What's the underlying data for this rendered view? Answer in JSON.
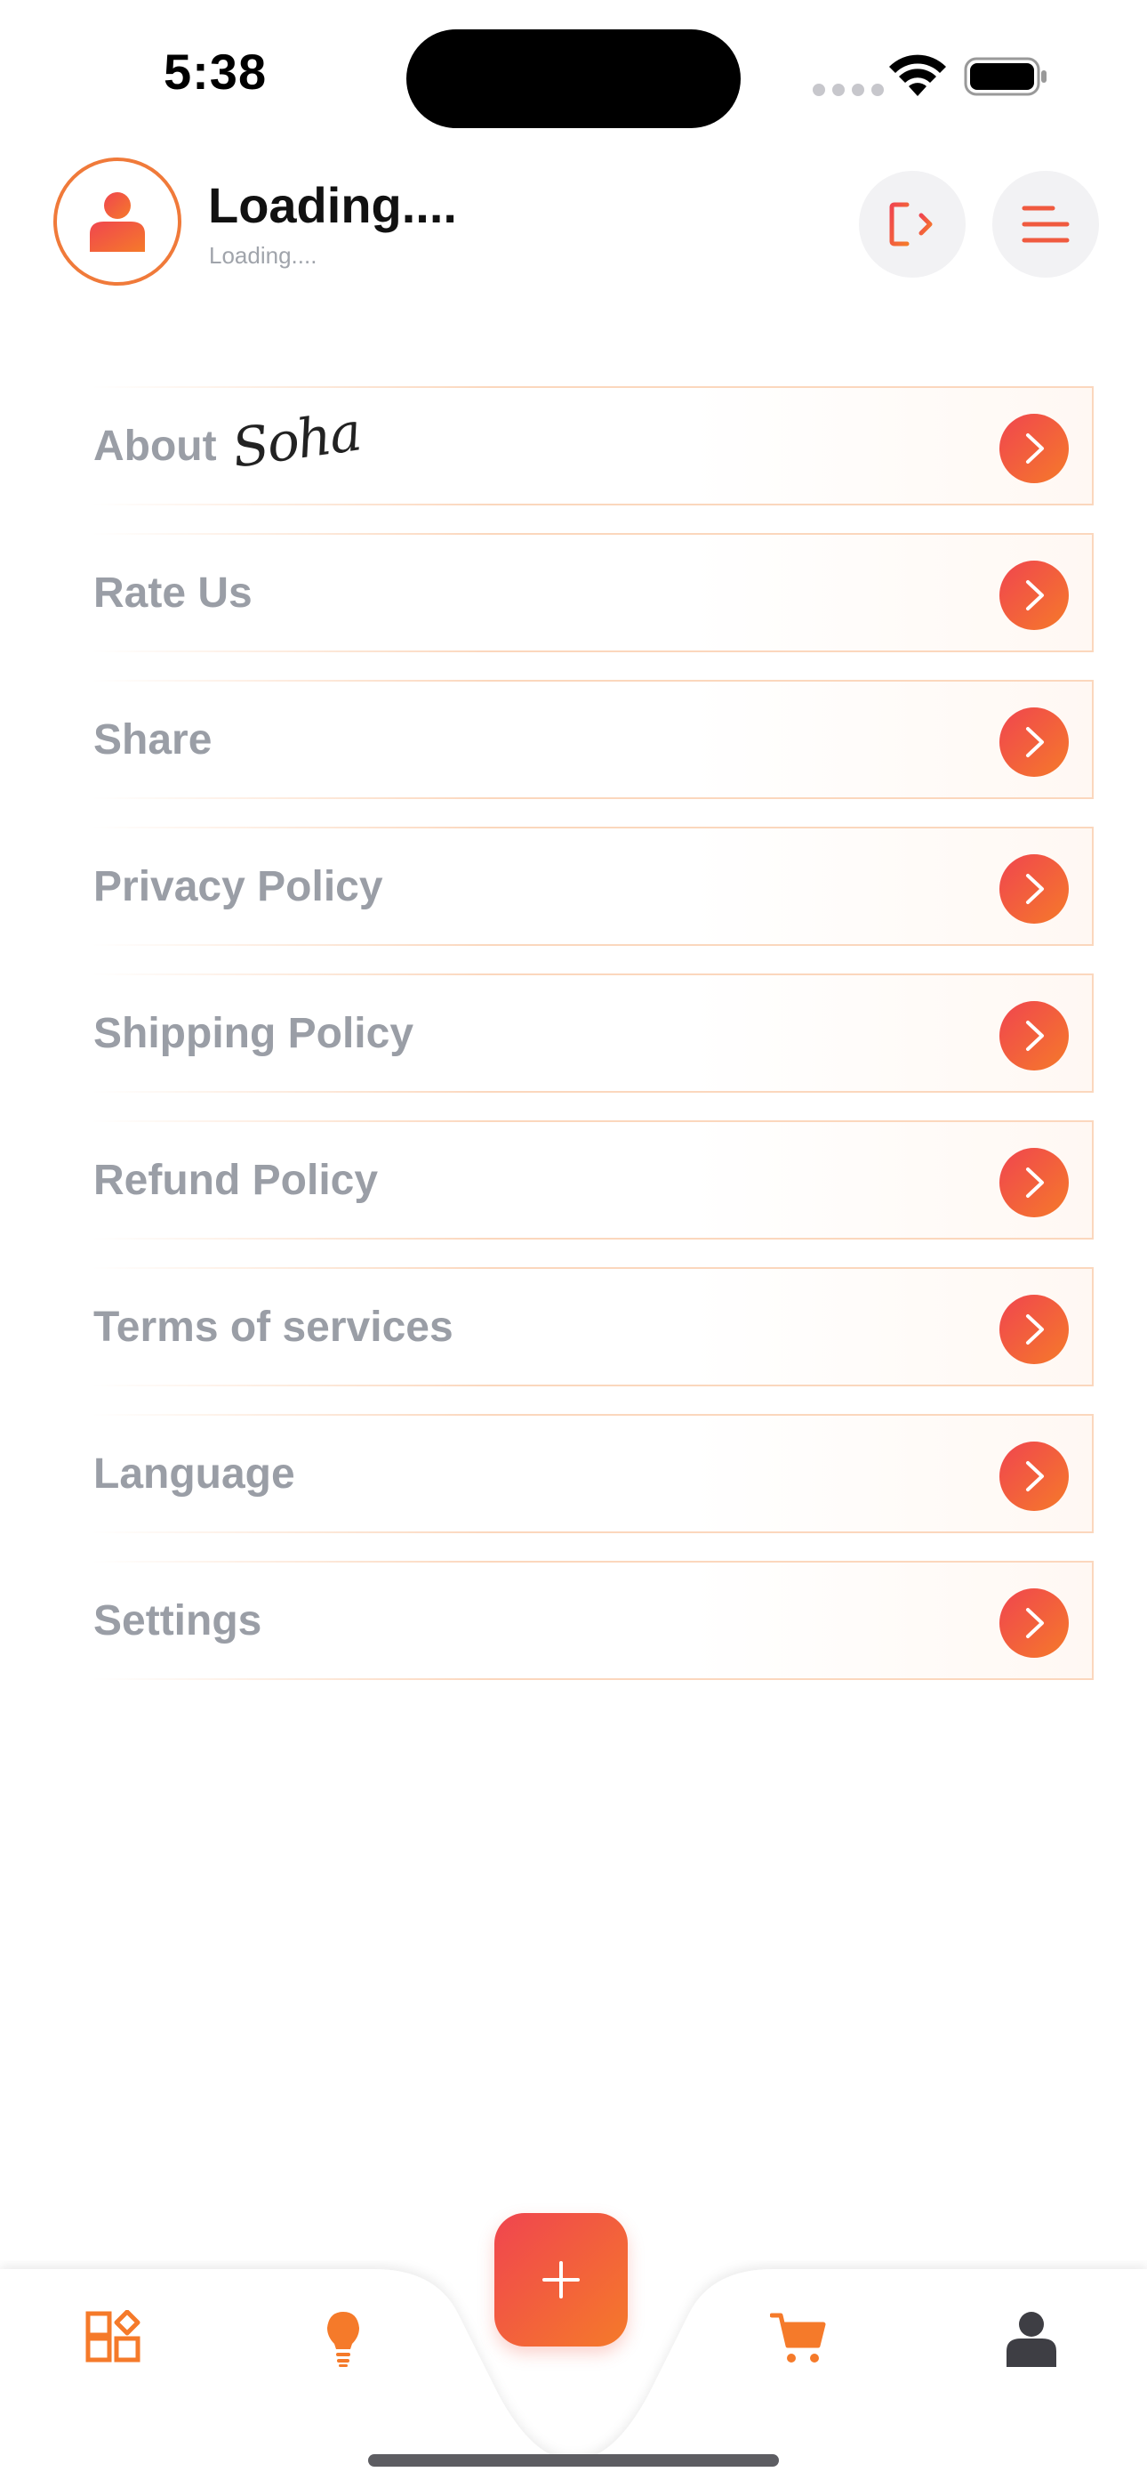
{
  "status_bar": {
    "time": "5:38"
  },
  "header": {
    "user_name": "Loading....",
    "user_subtitle": "Loading....",
    "avatar_icon": "user-icon",
    "logout_icon": "logout-icon",
    "menu_icon": "menu-icon"
  },
  "menu": {
    "items": [
      {
        "label": "About",
        "signature": "Soha"
      },
      {
        "label": "Rate Us"
      },
      {
        "label": "Share"
      },
      {
        "label": "Privacy Policy"
      },
      {
        "label": "Shipping Policy"
      },
      {
        "label": "Refund Policy"
      },
      {
        "label": "Terms of services"
      },
      {
        "label": "Language"
      },
      {
        "label": "Settings"
      }
    ]
  },
  "bottom_nav": {
    "items": [
      {
        "icon": "categories-icon"
      },
      {
        "icon": "lightbulb-icon"
      },
      {
        "icon": "plus-icon"
      },
      {
        "icon": "cart-icon"
      },
      {
        "icon": "profile-icon"
      }
    ]
  },
  "colors": {
    "accent_start": "#f0454f",
    "accent_end": "#f57a2a",
    "label_gray": "#9a9ea6",
    "border_peach": "#fbd7bd"
  }
}
